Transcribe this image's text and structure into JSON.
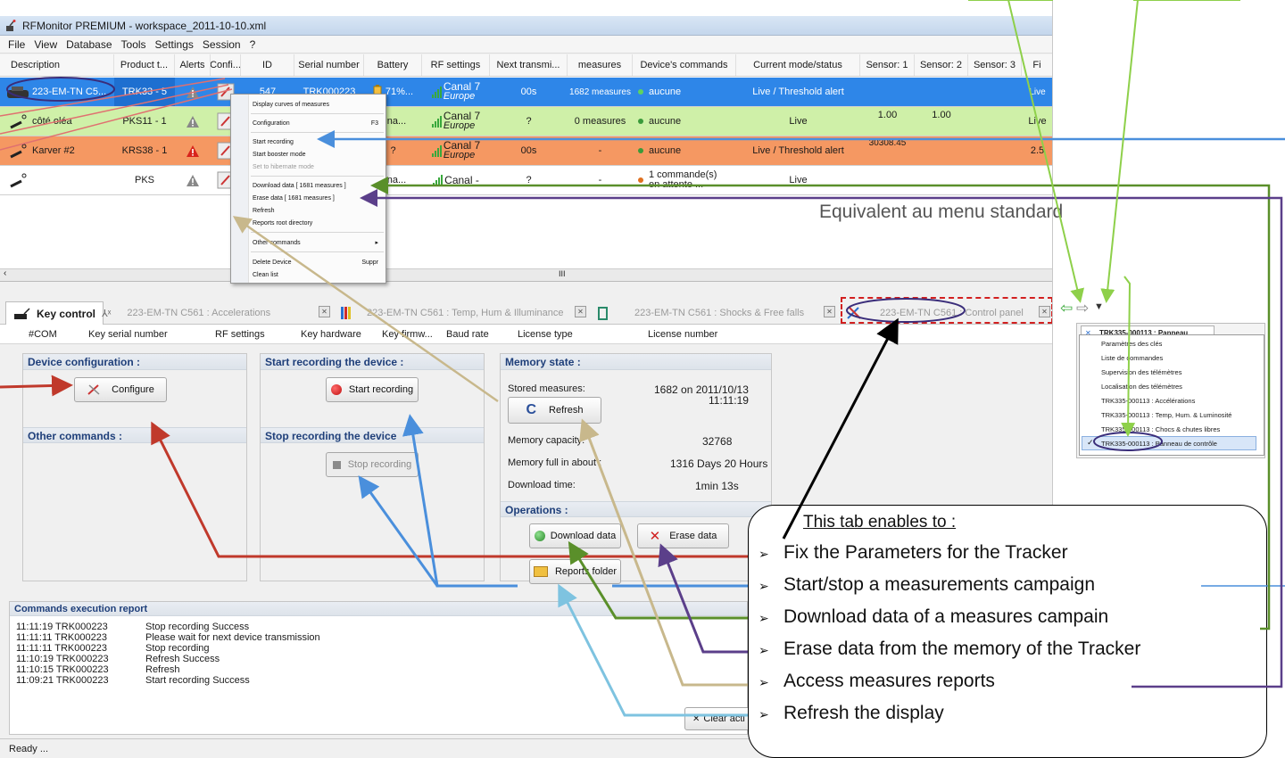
{
  "window": {
    "title": "RFMonitor PREMIUM - workspace_2011-10-10.xml"
  },
  "menubar": [
    "File",
    "View",
    "Database",
    "Tools",
    "Settings",
    "Session",
    "?"
  ],
  "grid": {
    "columns": [
      "Description",
      "Product t...",
      "Alerts",
      "Confi...",
      "ID",
      "Serial number",
      "Battery",
      "RF settings",
      "Next transmi...",
      "measures",
      "Device's commands",
      "Current mode/status",
      "Sensor: 1",
      "Sensor: 2",
      "Sensor: 3",
      "Fi"
    ],
    "rows": [
      {
        "description": "223-EM-TN C5...",
        "product": "TRK33 - 5",
        "id": "547",
        "serial": "TRK000223",
        "battery": "71%...",
        "rf_canal": "Canal 7",
        "rf_region": "Europe",
        "next": "00s",
        "measures": "1682 measures",
        "command": "aucune",
        "mode": "Live / Threshold alert",
        "sensor1": "",
        "sensor2": "",
        "extra": "Live"
      },
      {
        "description": "côté oléa",
        "product": "PKS11 - 1",
        "id": "",
        "serial": "",
        "battery": "Una...",
        "rf_canal": "Canal 7",
        "rf_region": "Europe",
        "next": "?",
        "measures": "0 measures",
        "command": "aucune",
        "mode": "Live",
        "sensor1": "1.00",
        "sensor2": "1.00",
        "extra": "Live"
      },
      {
        "description": "Karver #2",
        "product": "KRS38 - 1",
        "id": "",
        "serial": "",
        "battery": "?",
        "rf_canal": "Canal 7",
        "rf_region": "Europe",
        "next": "00s",
        "measures": "-",
        "command": "aucune",
        "mode": "Live / Threshold alert",
        "sensor1": "30308.45",
        "sensor2": "",
        "extra": "2.5"
      },
      {
        "description": "",
        "product": "PKS",
        "id": "",
        "serial": "",
        "battery": "Una...",
        "rf_canal": "Canal -",
        "rf_region": "",
        "next": "?",
        "measures": "-",
        "command": "1 commande(s) en attente ...",
        "mode": "Live",
        "sensor1": "",
        "sensor2": "",
        "extra": ""
      }
    ],
    "scroll_marker": "III"
  },
  "context_menu": [
    {
      "label": "Display curves of measures",
      "shortcut": "",
      "disabled": false,
      "color": "#2a6f2a"
    },
    {
      "label": "Configuration",
      "shortcut": "F3",
      "disabled": false,
      "color": "#555555"
    },
    {
      "label": "Start recording",
      "shortcut": "",
      "disabled": false,
      "color": "#cc2222"
    },
    {
      "label": "Start booster mode",
      "shortcut": "",
      "disabled": false,
      "color": "#3a9a3a"
    },
    {
      "label": "Set to hibernate mode",
      "shortcut": "",
      "disabled": true,
      "color": "#e07020"
    },
    {
      "label": "Download data  [ 1681 measures ]",
      "shortcut": "",
      "disabled": false,
      "color": "#3a9a3a"
    },
    {
      "label": "Erase data  [ 1681 measures ]",
      "shortcut": "",
      "disabled": false,
      "color": "#cc2222"
    },
    {
      "label": "Refresh",
      "shortcut": "",
      "disabled": false,
      "color": "#3a9a3a"
    },
    {
      "label": "Reports root directory",
      "shortcut": "",
      "disabled": false,
      "color": "#e0a020"
    },
    {
      "label": "Other commands",
      "shortcut": "▸",
      "disabled": false,
      "color": ""
    },
    {
      "label": "Delete Device",
      "shortcut": "Suppr",
      "disabled": false,
      "color": "#cc2222"
    },
    {
      "label": "Clean list",
      "shortcut": "",
      "disabled": false,
      "color": "#cc2222"
    }
  ],
  "tabs": {
    "active": "Key control",
    "items": [
      "223-EM-TN C561 : Accelerations",
      "223-EM-TN C561 : Temp, Hum & Illuminance",
      "223-EM-TN C561 : Shocks & Free falls",
      "223-EM-TN C561 : Control panel"
    ]
  },
  "key_columns": [
    "#COM",
    "Key serial number",
    "RF settings",
    "Key hardware",
    "Key firmw...",
    "Baud rate",
    "License type",
    "License number"
  ],
  "device_config": {
    "title": "Device configuration :",
    "configure": "Configure",
    "other_title": "Other commands :"
  },
  "recording": {
    "start_title": "Start recording the device :",
    "start_button": "Start recording",
    "stop_title": "Stop recording the device",
    "stop_button": "Stop recording"
  },
  "memory": {
    "title": "Memory state :",
    "stored_label": "Stored measures:",
    "stored_value": "1682  on  2011/10/13",
    "stored_time": "11:11:19",
    "refresh": "Refresh",
    "capacity_label": "Memory capacity:",
    "capacity_value": "32768",
    "full_label": "Memory full in about :",
    "full_value": "1316 Days 20 Hours",
    "download_label": "Download time:",
    "download_value": "1min 13s",
    "operations_title": "Operations :",
    "download_button": "Download data",
    "erase_button": "Erase data",
    "reports_button": "Reports folder"
  },
  "report": {
    "title": "Commands execution report",
    "lines": [
      {
        "time": "11:11:19  TRK000223",
        "msg": "Stop recording Success"
      },
      {
        "time": "11:11:11  TRK000223",
        "msg": "Please wait for next device transmission"
      },
      {
        "time": "11:11:11  TRK000223",
        "msg": "Stop recording"
      },
      {
        "time": "11:10:19  TRK000223",
        "msg": "Refresh Success"
      },
      {
        "time": "11:10:15  TRK000223",
        "msg": "Refresh"
      },
      {
        "time": "11:09:21  TRK000223",
        "msg": "Start recording Success"
      }
    ],
    "clear_button": "Clear acti"
  },
  "status": "Ready ...",
  "mini_window": {
    "tab": "TRK335-000113 : Panneau",
    "items": [
      "Paramètres des clés",
      "Liste de commandes",
      "Supervision des télémètres",
      "Localisation des télémètres",
      "TRK335-000113 : Accélérations",
      "TRK335-000113 : Temp, Hum. & Luminosité",
      "TRK335-000113 : Chocs & chutes libres",
      "TRK335-000113 : Panneau de contrôle"
    ]
  },
  "annotation": {
    "equivalent": "Equivalent au menu standard",
    "title": "This tab enables to :",
    "items": [
      "Fix the Parameters for the Tracker",
      "Start/stop a measurements campaign",
      "Download data of a measures campain",
      "Erase data from the memory of the Tracker",
      "Access measures reports",
      "Refresh the display"
    ]
  },
  "colors": {
    "row_selected": "#2e86e8",
    "row_green": "#cff0a8",
    "row_orange": "#f59862",
    "panel_title": "#1f3f7a",
    "arrow_red": "#c0392b",
    "arrow_blue": "#4a8fdc",
    "arrow_green": "#5a8f2a",
    "arrow_purple": "#5b3f8a",
    "arrow_tan": "#c8b88c",
    "arrow_lightblue": "#7ec3e0",
    "arrow_lime": "#8ed04a"
  }
}
